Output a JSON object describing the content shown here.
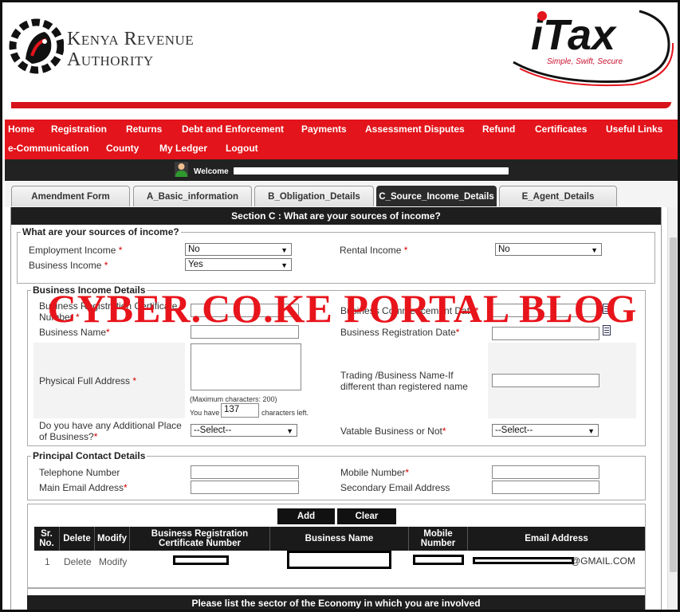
{
  "header": {
    "kra_line1": "Kenya Revenue",
    "kra_line2": "Authority",
    "itax_logo": "iTax",
    "itax_tagline": "Simple, Swift, Secure",
    "brand_red": "#e3141b"
  },
  "nav": {
    "row1": [
      "Home",
      "Registration",
      "Returns",
      "Debt and Enforcement",
      "Payments",
      "Assessment Disputes",
      "Refund",
      "Certificates",
      "Useful Links"
    ],
    "row2": [
      "e-Communication",
      "County",
      "My Ledger",
      "Logout"
    ]
  },
  "welcome": {
    "label": "Welcome"
  },
  "tabs": [
    "Amendment Form",
    "A_Basic_information",
    "B_Obligation_Details",
    "C_Source_Income_Details",
    "E_Agent_Details"
  ],
  "section_title": "Section C : What are your sources of income?",
  "sources": {
    "legend": "What are your sources of income?",
    "employment_label": "Employment Income",
    "employment_value": "No",
    "rental_label": "Rental Income",
    "rental_value": "No",
    "business_label": "Business Income",
    "business_value": "Yes"
  },
  "business": {
    "legend": "Business Income Details",
    "reg_cert_label": "Business Registration Certificate Number",
    "commencement_label": "Business Commencement Date",
    "name_label": "Business Name",
    "reg_date_label": "Business Registration Date",
    "address_label": "Physical Full Address",
    "trading_label": "Trading /Business Name-If different than registered name",
    "max_chars": "(Maximum characters: 200)",
    "you_have": "You have",
    "chars_left_value": "137",
    "chars_left": "characters left.",
    "additional_label": "Do you have any Additional Place of Business?",
    "additional_value": "--Select--",
    "vatable_label": "Vatable Business or Not",
    "vatable_value": "--Select--",
    "required_mark": "*"
  },
  "contact": {
    "legend": "Principal Contact Details",
    "telephone_label": "Telephone Number",
    "mobile_label": "Mobile Number",
    "email_label": "Main Email Address",
    "secondary_email_label": "Secondary Email Address"
  },
  "table": {
    "add_label": "Add",
    "clear_label": "Clear",
    "headers": [
      "Sr. No.",
      "Delete",
      "Modify",
      "Business Registration Certificate Number",
      "Business Name",
      "Mobile Number",
      "Email Address"
    ],
    "row": {
      "sr": "1",
      "delete": "Delete",
      "modify": "Modify",
      "email_suffix": "@GMAIL.COM"
    }
  },
  "watermark": "CYBER.CO.KE PORTAL BLOG",
  "sector_prompt": "Please list the sector of the Economy in which you are involved"
}
